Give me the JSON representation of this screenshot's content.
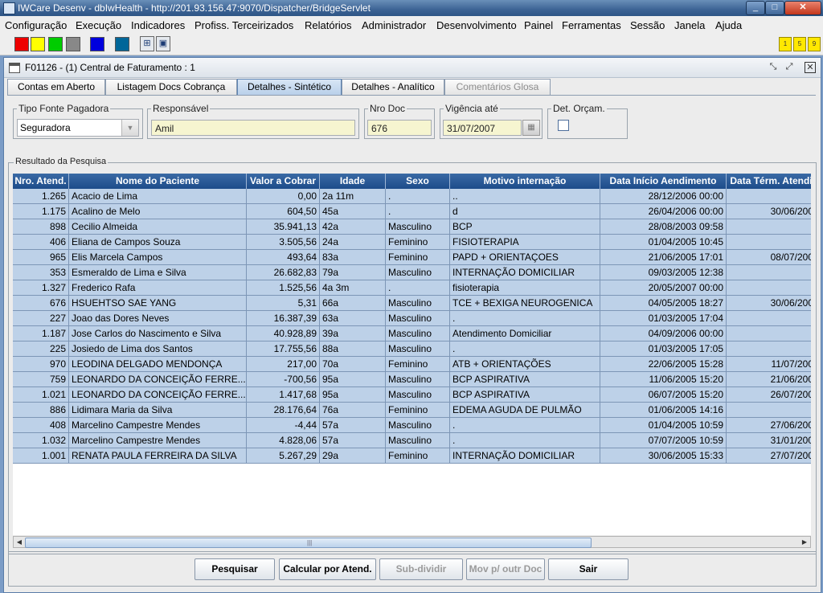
{
  "window": {
    "title": "IWCare Desenv - dbIwHealth - http://201.93.156.47:9070/Dispatcher/BridgeServlet",
    "min_icon": "minimize-icon",
    "max_icon": "maximize-icon",
    "close_icon": "close-icon",
    "min_glyph": "_",
    "max_glyph": "□",
    "close_glyph": "✕"
  },
  "menu": [
    "Configuração",
    "Execução",
    "Indicadores",
    "Profiss. Terceirizados",
    "Relatórios",
    "Administrador",
    "Desenvolvimento",
    "Painel",
    "Ferramentas",
    "Sessão",
    "Janela",
    "Ajuda"
  ],
  "toolbar": {
    "swatches": [
      "#ee0000",
      "#ffff00",
      "#00cc00",
      "#888888",
      "#0000dd",
      "#006699"
    ],
    "icons": [
      "tree-icon",
      "windows-icon"
    ],
    "icon_glyphs": [
      "⊞",
      "▣"
    ],
    "mini_buttons": [
      "1",
      "5",
      "9"
    ]
  },
  "inner": {
    "title": "F01126 - (1) Central de Faturamento : 1",
    "title_icon": "document-window-icon"
  },
  "tabs": [
    {
      "label": "Contas em Aberto",
      "state": "normal"
    },
    {
      "label": "Listagem Docs Cobrança",
      "state": "normal"
    },
    {
      "label": "Detalhes - Sintético",
      "state": "active"
    },
    {
      "label": "Detalhes - Analítico",
      "state": "normal"
    },
    {
      "label": "Comentários Glosa",
      "state": "disabled"
    }
  ],
  "filters": {
    "tipo_fonte": {
      "label": "Tipo Fonte Pagadora",
      "value": "Seguradora"
    },
    "responsavel": {
      "label": "Responsável",
      "value": "Amil"
    },
    "nro_doc": {
      "label": "Nro Doc",
      "value": "676"
    },
    "vigencia": {
      "label": "Vigência até",
      "value": "31/07/2007"
    },
    "det_orcam": {
      "label": "Det. Orçam.",
      "checked": false
    }
  },
  "results": {
    "label": "Resultado da Pesquisa",
    "columns": [
      "Nro. Atend.",
      "Nome do Paciente",
      "Valor a Cobrar",
      "Idade",
      "Sexo",
      "Motivo internação",
      "Data Início Aendimento",
      "Data Térm. Atendi"
    ],
    "rows": [
      [
        "1.265",
        "Acacio de Lima",
        "0,00",
        "2a 11m",
        ".",
        "..",
        "28/12/2006 00:00",
        ""
      ],
      [
        "1.175",
        "Acalino de Melo",
        "604,50",
        "45a",
        ".",
        "d",
        "26/04/2006 00:00",
        "30/06/200"
      ],
      [
        "898",
        "Cecilio Almeida",
        "35.941,13",
        "42a",
        "Masculino",
        "BCP",
        "28/08/2003 09:58",
        ""
      ],
      [
        "406",
        "Eliana de Campos Souza",
        "3.505,56",
        "24a",
        "Feminino",
        "FISIOTERAPIA",
        "01/04/2005 10:45",
        ""
      ],
      [
        "965",
        "Elis Marcela Campos",
        "493,64",
        "83a",
        "Feminino",
        "PAPD + ORIENTAÇOES",
        "21/06/2005 17:01",
        "08/07/200"
      ],
      [
        "353",
        "Esmeraldo de Lima e Silva",
        "26.682,83",
        "79a",
        "Masculino",
        "INTERNAÇÃO DOMICILIAR",
        "09/03/2005 12:38",
        ""
      ],
      [
        "1.327",
        "Frederico Rafa",
        "1.525,56",
        "4a 3m",
        ".",
        "fisioterapia",
        "20/05/2007 00:00",
        ""
      ],
      [
        "676",
        "HSUEHTSO SAE YANG",
        "5,31",
        "66a",
        "Masculino",
        "TCE + BEXIGA NEUROGENICA",
        "04/05/2005 18:27",
        "30/06/200"
      ],
      [
        "227",
        "Joao das Dores Neves",
        "16.387,39",
        "63a",
        "Masculino",
        ".",
        "01/03/2005 17:04",
        ""
      ],
      [
        "1.187",
        "Jose Carlos do Nascimento e Silva",
        "40.928,89",
        "39a",
        "Masculino",
        "Atendimento Domiciliar",
        "04/09/2006 00:00",
        ""
      ],
      [
        "225",
        "Josiedo de Lima dos Santos",
        "17.755,56",
        "88a",
        "Masculino",
        ".",
        "01/03/2005 17:05",
        ""
      ],
      [
        "970",
        "LEODINA DELGADO MENDONÇA",
        "217,00",
        "70a",
        "Feminino",
        "ATB + ORIENTAÇÕES",
        "22/06/2005 15:28",
        "11/07/200"
      ],
      [
        "759",
        "LEONARDO DA CONCEIÇÃO FERRE...",
        "-700,56",
        "95a",
        "Masculino",
        "BCP ASPIRATIVA",
        "11/06/2005 15:20",
        "21/06/200"
      ],
      [
        "1.021",
        "LEONARDO DA CONCEIÇÃO FERRE...",
        "1.417,68",
        "95a",
        "Masculino",
        "BCP ASPIRATIVA",
        "06/07/2005 15:20",
        "26/07/200"
      ],
      [
        "886",
        "Lidimara Maria da Silva",
        "28.176,64",
        "76a",
        "Feminino",
        "EDEMA AGUDA DE PULMÃO",
        "01/06/2005 14:16",
        ""
      ],
      [
        "408",
        "Marcelino Campestre Mendes",
        "-4,44",
        "57a",
        "Masculino",
        ".",
        "01/04/2005 10:59",
        "27/06/200"
      ],
      [
        "1.032",
        "Marcelino Campestre Mendes",
        "4.828,06",
        "57a",
        "Masculino",
        ".",
        "07/07/2005 10:59",
        "31/01/200"
      ],
      [
        "1.001",
        "RENATA PAULA FERREIRA DA SILVA",
        "5.267,29",
        "29a",
        "Feminino",
        "INTERNAÇÃO DOMICILIAR",
        "30/06/2005 15:33",
        "27/07/200"
      ]
    ]
  },
  "scroll": {
    "left": "◀",
    "right": "▶",
    "grip": "|||"
  },
  "buttons": [
    {
      "label": "Pesquisar",
      "enabled": true
    },
    {
      "label": "Calcular por Atend.",
      "enabled": true
    },
    {
      "label": "Sub-dividir",
      "enabled": false
    },
    {
      "label": "Mov p/ outr Doc",
      "enabled": false
    },
    {
      "label": "Sair",
      "enabled": true
    }
  ]
}
